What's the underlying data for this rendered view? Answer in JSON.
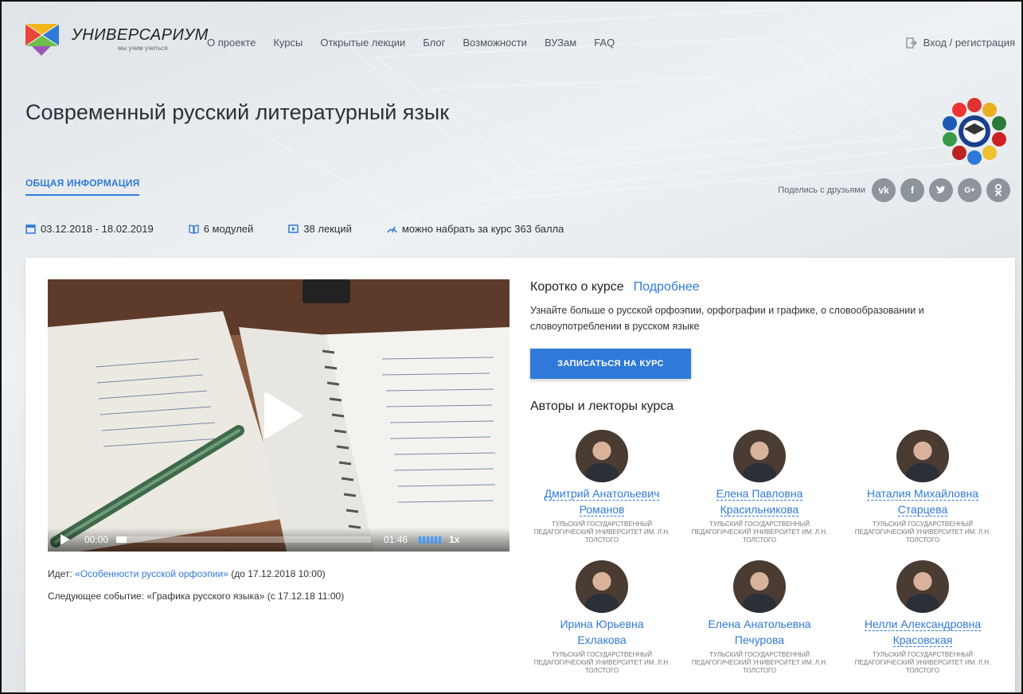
{
  "header": {
    "logo_text": "УНИВЕРСАРИУМ",
    "logo_sub": "мы учим учиться",
    "nav": [
      "О проекте",
      "Курсы",
      "Открытые лекции",
      "Блог",
      "Возможности",
      "ВУЗам",
      "FAQ"
    ],
    "login": "Вход / регистрация"
  },
  "course": {
    "title": "Современный русский литературный язык",
    "tab_active": "ОБЩАЯ ИНФОРМАЦИЯ",
    "share_label": "Поделись с друзьями",
    "social": [
      "vk",
      "f",
      "t",
      "G+",
      "ok"
    ],
    "meta": {
      "dates": "03.12.2018 - 18.02.2019",
      "modules": "6 модулей",
      "lectures": "38 лекций",
      "points": "можно набрать за курс 363 балла"
    }
  },
  "video": {
    "current_time": "00:00",
    "duration": "01:46",
    "speed": "1x",
    "progress_fraction": 0.04
  },
  "events": {
    "current_prefix": "Идет: ",
    "current_link": "«Особенности русской орфоэпии»",
    "current_suffix": " (до 17.12.2018 10:00)",
    "next": "Следующее событие: «Графика русского языка» (с 17.12.18 11:00)"
  },
  "about": {
    "heading": "Коротко о курсе",
    "more": "Подробнее",
    "text": "Узнайте больше о русской орфоэпии, орфографии и графике, о словообразовании и словоупотреблении в русском языке",
    "enroll": "ЗАПИСАТЬСЯ НА КУРС"
  },
  "authors": {
    "heading": "Авторы и лекторы курса",
    "list": [
      {
        "name1": "Дмитрий Анатольевич",
        "name2": "Романов",
        "uni": "ТУЛЬСКИЙ ГОСУДАРСТВЕННЫЙ ПЕДАГОГИЧЕСКИЙ УНИВЕРСИТЕТ ИМ. Л.Н. ТОЛСТОГО"
      },
      {
        "name1": "Елена Павловна",
        "name2": "Красильникова",
        "uni": "ТУЛЬСКИЙ ГОСУДАРСТВЕННЫЙ ПЕДАГОГИЧЕСКИЙ УНИВЕРСИТЕТ ИМ. Л.Н. ТОЛСТОГО"
      },
      {
        "name1": "Наталия Михайловна",
        "name2": "Старцева",
        "uni": "ТУЛЬСКИЙ ГОСУДАРСТВЕННЫЙ ПЕДАГОГИЧЕСКИЙ УНИВЕРСИТЕТ ИМ. Л.Н. ТОЛСТОГО"
      },
      {
        "name1": "Ирина Юрьевна",
        "name2": "Ехлакова",
        "uni": "ТУЛЬСКИЙ ГОСУДАРСТВЕННЫЙ ПЕДАГОГИЧЕСКИЙ УНИВЕРСИТЕТ ИМ. Л.Н. ТОЛСТОГО"
      },
      {
        "name1": "Елена Анатольевна",
        "name2": "Печурова",
        "uni": "ТУЛЬСКИЙ ГОСУДАРСТВЕННЫЙ ПЕДАГОГИЧЕСКИЙ УНИВЕРСИТЕТ ИМ. Л.Н. ТОЛСТОГО"
      },
      {
        "name1": "Нелли Александровна",
        "name2": "Красовская",
        "uni": "ТУЛЬСКИЙ ГОСУДАРСТВЕННЫЙ ПЕДАГОГИЧЕСКИЙ УНИВЕРСИТЕТ ИМ. Л.Н. ТОЛСТОГО"
      }
    ]
  },
  "colors": {
    "accent": "#2f7ad8",
    "social_bg": "#8d949c",
    "text": "#333333"
  }
}
